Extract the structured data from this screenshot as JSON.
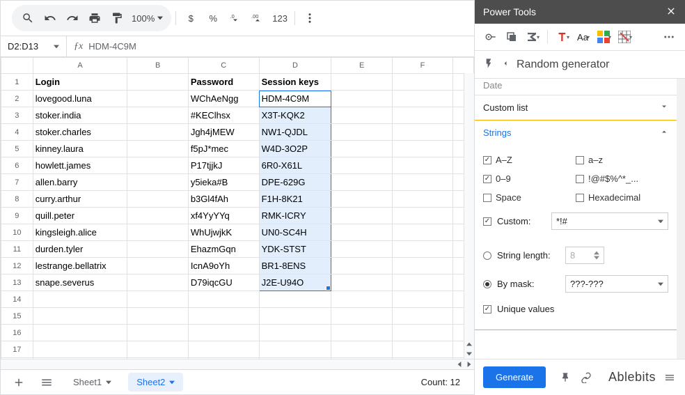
{
  "toolbar": {
    "zoom": "100%",
    "num_format": "123"
  },
  "formula_bar": {
    "name_box": "D2:D13",
    "formula": "HDM-4C9M"
  },
  "columns": [
    "A",
    "B",
    "C",
    "D",
    "E",
    "F"
  ],
  "headers": {
    "login": "Login",
    "password": "Password",
    "session": "Session keys"
  },
  "rows": [
    {
      "login": "lovegood.luna",
      "password": "WChAeNgg",
      "session": "HDM-4C9M"
    },
    {
      "login": "stoker.india",
      "password": "#KEClhsx",
      "session": "X3T-KQK2"
    },
    {
      "login": "stoker.charles",
      "password": "Jgh4jMEW",
      "session": "NW1-QJDL"
    },
    {
      "login": "kinney.laura",
      "password": "f5pJ*mec",
      "session": "W4D-3O2P"
    },
    {
      "login": "howlett.james",
      "password": "P17tjjkJ",
      "session": "6R0-X61L"
    },
    {
      "login": "allen.barry",
      "password": "y5ieka#B",
      "session": "DPE-629G"
    },
    {
      "login": "curry.arthur",
      "password": "b3Gl4fAh",
      "session": "F1H-8K21"
    },
    {
      "login": "quill.peter",
      "password": "xf4YyYYq",
      "session": "RMK-ICRY"
    },
    {
      "login": "kingsleigh.alice",
      "password": "WhUjwjkK",
      "session": "UN0-SC4H"
    },
    {
      "login": "durden.tyler",
      "password": "EhazmGqn",
      "session": "YDK-STST"
    },
    {
      "login": "lestrange.bellatrix",
      "password": "IcnA9oYh",
      "session": "BR1-8ENS"
    },
    {
      "login": "snape.severus",
      "password": "D79iqcGU",
      "session": "J2E-U94O"
    }
  ],
  "sheets": {
    "tab1": "Sheet1",
    "tab2": "Sheet2"
  },
  "status": {
    "count": "Count: 12"
  },
  "sidebar": {
    "title": "Power Tools",
    "generator_title": "Random generator",
    "partial_section": "Date",
    "custom_list": "Custom list",
    "strings_title": "Strings",
    "checks": {
      "AZ": "A–Z",
      "az": "a–z",
      "digits": "0–9",
      "symbols": "!@#$%^*_...",
      "space": "Space",
      "hex": "Hexadecimal",
      "custom": "Custom:",
      "custom_val": "*!#"
    },
    "string_length_label": "String length:",
    "string_length_val": "8",
    "by_mask_label": "By mask:",
    "by_mask_val": "???-???",
    "unique": "Unique values",
    "generate": "Generate",
    "brand": "Ablebits"
  }
}
